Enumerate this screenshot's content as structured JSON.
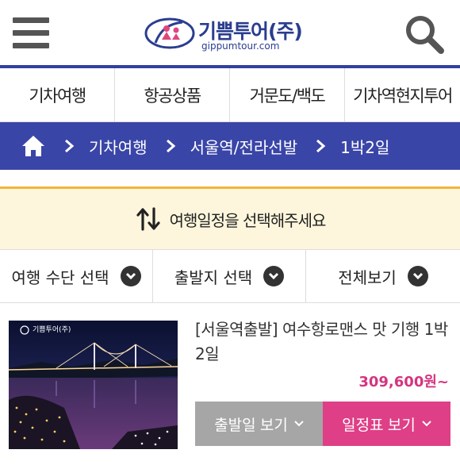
{
  "header": {
    "logo_text": "기쁨투어(주)",
    "logo_sub": "gippumtour.com"
  },
  "categories": [
    "기차여행",
    "항공상품",
    "거문도/백도",
    "기차역현지투어"
  ],
  "breadcrumb": [
    "기차여행",
    "서울역/전라선발",
    "1박2일"
  ],
  "banner": {
    "text": "여행일정을 선택해주세요",
    "bg_color": "#fdf6dc",
    "line_color": "#f2b43a"
  },
  "filters": [
    "여행 수단 선택",
    "출발지 선택",
    "전체보기"
  ],
  "product": {
    "image_logo": "기쁨투어(주)",
    "title": "[서울역출발] 여수항로맨스 맛 기행 1박2일",
    "price": "309,600원~",
    "depart_button": "출발일 보기",
    "schedule_button": "일정표 보기"
  },
  "colors": {
    "brand_blue": "#3a45a8",
    "accent_pink": "#de3f87",
    "price_pink": "#d4357f",
    "button_gray": "#a6a6a6"
  }
}
